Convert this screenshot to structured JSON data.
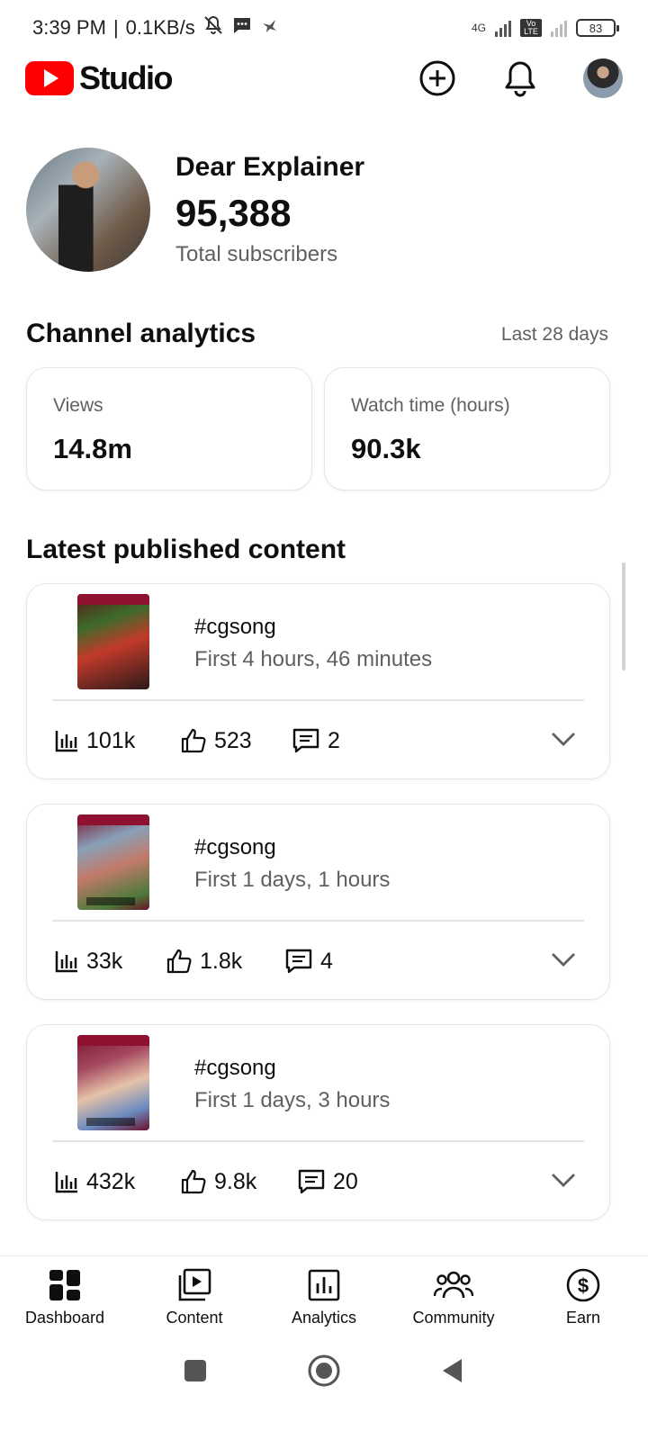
{
  "status_bar": {
    "time": "3:39 PM",
    "separator": "|",
    "net_speed": "0.1KB/s",
    "network_label": "4G",
    "volte_label": "Vo LTE",
    "battery": "83"
  },
  "app": {
    "title": "Studio",
    "icons": [
      "create-icon",
      "notifications-icon",
      "account-avatar"
    ]
  },
  "channel": {
    "name": "Dear Explainer",
    "subscribers": "95,388",
    "subscribers_label": "Total subscribers"
  },
  "analytics": {
    "title": "Channel analytics",
    "period": "Last 28 days",
    "cards": [
      {
        "label": "Views",
        "value": "14.8m"
      },
      {
        "label": "Watch time (hours)",
        "value": "90.3k"
      }
    ]
  },
  "latest": {
    "title": "Latest published content",
    "items": [
      {
        "title": "#cgsong",
        "subtitle": "First 4 hours, 46 minutes",
        "views": "101k",
        "likes": "523",
        "comments": "2"
      },
      {
        "title": "#cgsong",
        "subtitle": "First 1 days, 1 hours",
        "views": "33k",
        "likes": "1.8k",
        "comments": "4"
      },
      {
        "title": "#cgsong",
        "subtitle": "First 1 days, 3 hours",
        "views": "432k",
        "likes": "9.8k",
        "comments": "20"
      }
    ]
  },
  "bottom_nav": [
    {
      "label": "Dashboard",
      "icon": "dashboard-icon"
    },
    {
      "label": "Content",
      "icon": "content-icon"
    },
    {
      "label": "Analytics",
      "icon": "analytics-icon"
    },
    {
      "label": "Community",
      "icon": "community-icon"
    },
    {
      "label": "Earn",
      "icon": "earn-icon"
    }
  ],
  "colors": {
    "brand_red": "#ff0000",
    "text_primary": "#0f0f0f",
    "text_secondary": "#606060",
    "divider": "#e5e5e5"
  }
}
